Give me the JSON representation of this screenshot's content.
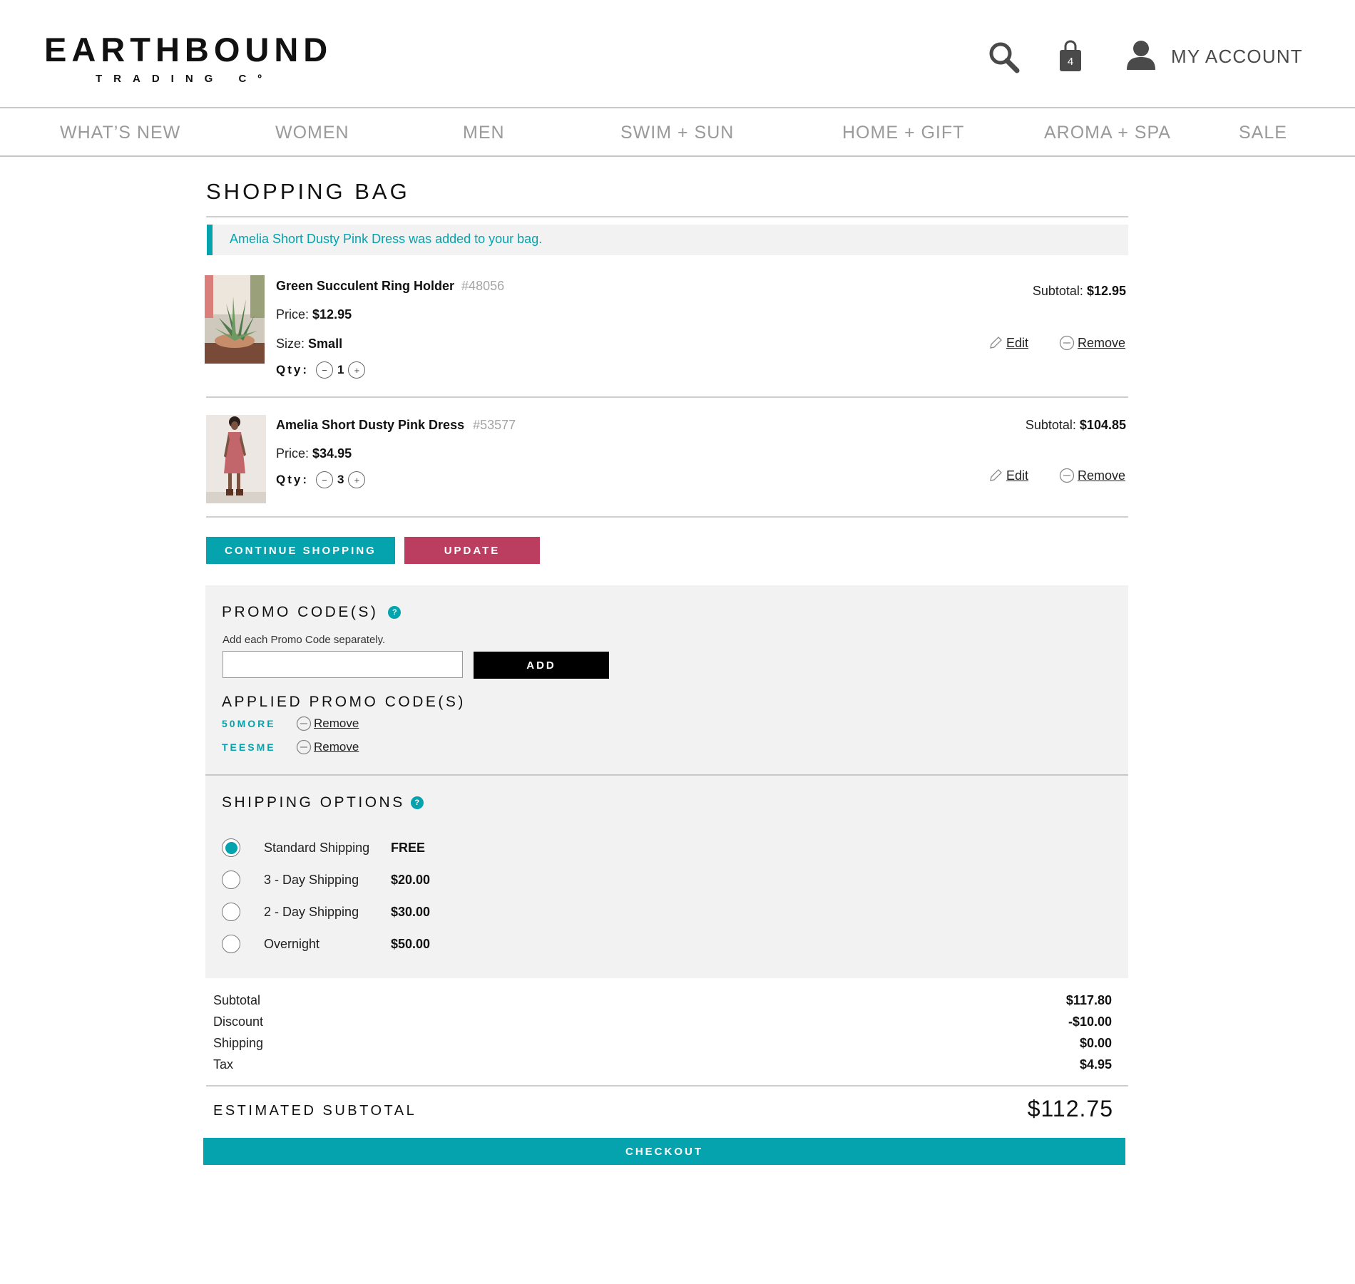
{
  "brand": {
    "name": "EARTHBOUND",
    "sub": "TRADING Cº"
  },
  "header": {
    "bag_count": "4",
    "account_label": "MY ACCOUNT"
  },
  "nav": [
    "WHAT’S NEW",
    "WOMEN",
    "MEN",
    "SWIM + SUN",
    "HOME + GIFT",
    "AROMA + SPA",
    "SALE"
  ],
  "page_title": "SHOPPING BAG",
  "notice": "Amelia Short Dusty Pink Dress was added to your bag.",
  "labels": {
    "price": "Price:",
    "size": "Size:",
    "qty": "Qty:",
    "subtotal": "Subtotal:",
    "edit": "Edit",
    "remove": "Remove"
  },
  "items": [
    {
      "name": "Green Succulent Ring Holder",
      "sku": "#48056",
      "price": "$12.95",
      "size": "Small",
      "qty": "1",
      "subtotal": "$12.95"
    },
    {
      "name": "Amelia Short Dusty Pink Dress",
      "sku": "#53577",
      "price": "$34.95",
      "qty": "3",
      "subtotal": "$104.85"
    }
  ],
  "buttons": {
    "continue": "CONTINUE SHOPPING",
    "update": "UPDATE",
    "add": "ADD",
    "checkout": "CHECKOUT"
  },
  "promo": {
    "title": "PROMO CODE(S)",
    "help": "Add each Promo Code separately.",
    "input_value": "",
    "input_placeholder": "",
    "applied_title": "APPLIED PROMO CODE(S)",
    "codes": [
      "50MORE",
      "TEESME"
    ],
    "remove_label": "Remove"
  },
  "shipping": {
    "title": "SHIPPING OPTIONS",
    "options": [
      {
        "label": "Standard Shipping",
        "price": "FREE",
        "selected": true
      },
      {
        "label": "3 - Day Shipping",
        "price": "$20.00",
        "selected": false
      },
      {
        "label": "2 - Day Shipping",
        "price": "$30.00",
        "selected": false
      },
      {
        "label": "Overnight",
        "price": "$50.00",
        "selected": false
      }
    ]
  },
  "totals": [
    {
      "label": "Subtotal",
      "value": "$117.80"
    },
    {
      "label": "Discount",
      "value": "-$10.00"
    },
    {
      "label": "Shipping",
      "value": "$0.00"
    },
    {
      "label": "Tax",
      "value": "$4.95"
    }
  ],
  "estimated": {
    "label": "ESTIMATED SUBTOTAL",
    "value": "$112.75"
  },
  "colors": {
    "accent": "#04a3ad",
    "update": "#bb3d60",
    "add": "#000000",
    "panel": "#f2f2f2",
    "nav_text": "#9a9a9a"
  }
}
